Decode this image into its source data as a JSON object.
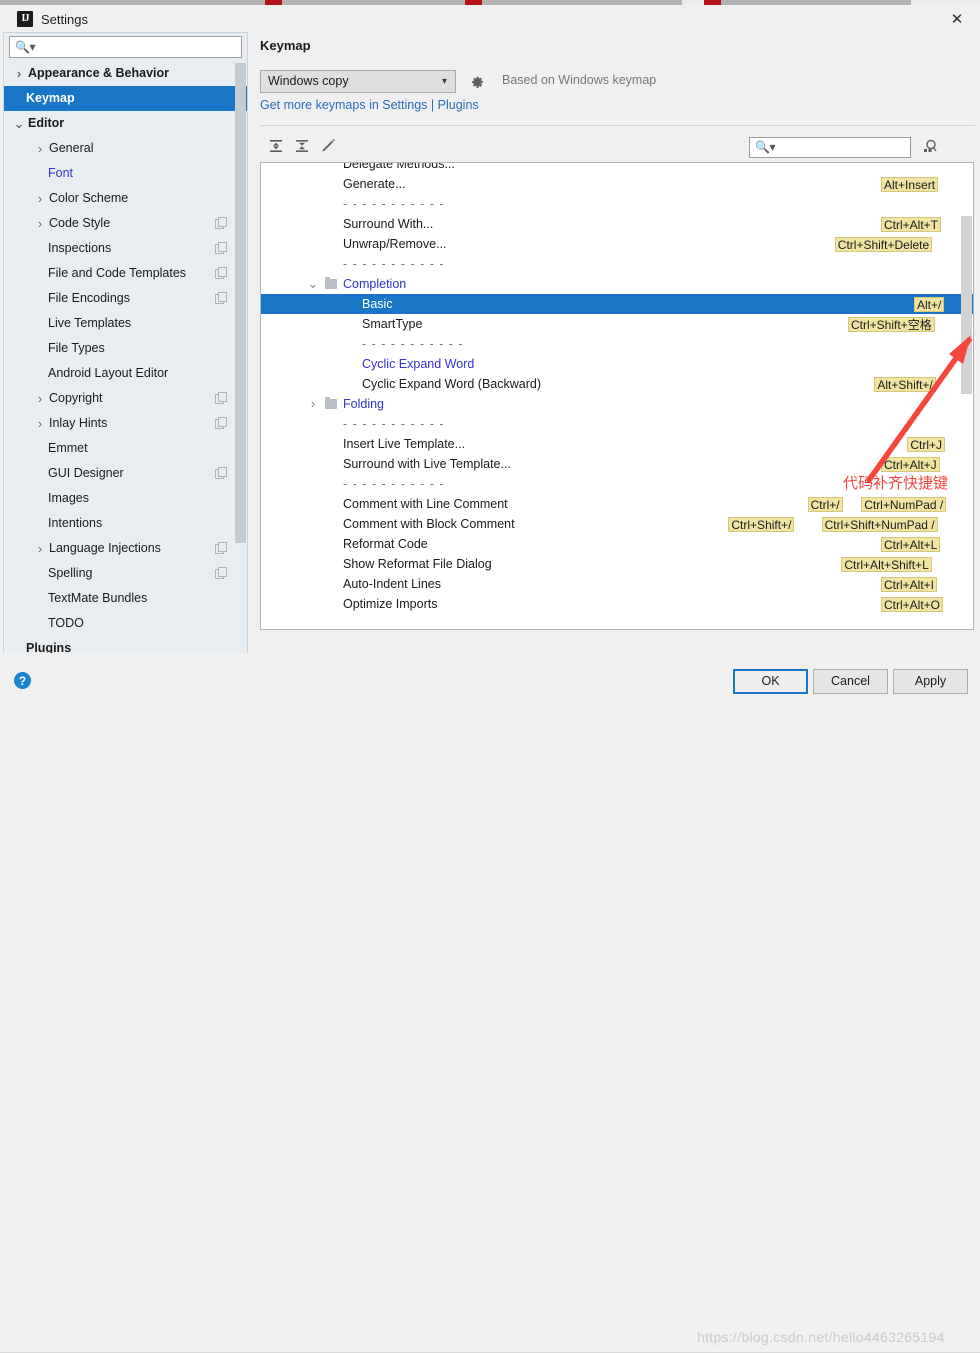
{
  "window": {
    "title": "Settings",
    "logo_text": "IJ",
    "close_icon": "close-icon"
  },
  "sidebar": {
    "search_placeholder": "",
    "search_icon": "search-icon",
    "items": [
      {
        "label": "Appearance & Behavior",
        "indent": 7,
        "chevron": "right",
        "bold": true,
        "selected": false,
        "copy": false
      },
      {
        "label": "Keymap",
        "indent": 22,
        "chevron": "",
        "bold": true,
        "selected": true,
        "copy": false
      },
      {
        "label": "Editor",
        "indent": 7,
        "chevron": "down",
        "bold": true,
        "selected": false,
        "copy": false
      },
      {
        "label": "General",
        "indent": 28,
        "chevron": "right",
        "bold": false,
        "selected": false,
        "copy": false
      },
      {
        "label": "Font",
        "indent": 44,
        "chevron": "",
        "bold": false,
        "selected": false,
        "copy": false,
        "link": true
      },
      {
        "label": "Color Scheme",
        "indent": 28,
        "chevron": "right",
        "bold": false,
        "selected": false,
        "copy": false
      },
      {
        "label": "Code Style",
        "indent": 28,
        "chevron": "right",
        "bold": false,
        "selected": false,
        "copy": true
      },
      {
        "label": "Inspections",
        "indent": 44,
        "chevron": "",
        "bold": false,
        "selected": false,
        "copy": true
      },
      {
        "label": "File and Code Templates",
        "indent": 44,
        "chevron": "",
        "bold": false,
        "selected": false,
        "copy": true
      },
      {
        "label": "File Encodings",
        "indent": 44,
        "chevron": "",
        "bold": false,
        "selected": false,
        "copy": true
      },
      {
        "label": "Live Templates",
        "indent": 44,
        "chevron": "",
        "bold": false,
        "selected": false,
        "copy": false
      },
      {
        "label": "File Types",
        "indent": 44,
        "chevron": "",
        "bold": false,
        "selected": false,
        "copy": false
      },
      {
        "label": "Android Layout Editor",
        "indent": 44,
        "chevron": "",
        "bold": false,
        "selected": false,
        "copy": false
      },
      {
        "label": "Copyright",
        "indent": 28,
        "chevron": "right",
        "bold": false,
        "selected": false,
        "copy": true
      },
      {
        "label": "Inlay Hints",
        "indent": 28,
        "chevron": "right",
        "bold": false,
        "selected": false,
        "copy": true
      },
      {
        "label": "Emmet",
        "indent": 44,
        "chevron": "",
        "bold": false,
        "selected": false,
        "copy": false
      },
      {
        "label": "GUI Designer",
        "indent": 44,
        "chevron": "",
        "bold": false,
        "selected": false,
        "copy": true
      },
      {
        "label": "Images",
        "indent": 44,
        "chevron": "",
        "bold": false,
        "selected": false,
        "copy": false
      },
      {
        "label": "Intentions",
        "indent": 44,
        "chevron": "",
        "bold": false,
        "selected": false,
        "copy": false
      },
      {
        "label": "Language Injections",
        "indent": 28,
        "chevron": "right",
        "bold": false,
        "selected": false,
        "copy": true
      },
      {
        "label": "Spelling",
        "indent": 44,
        "chevron": "",
        "bold": false,
        "selected": false,
        "copy": true
      },
      {
        "label": "TextMate Bundles",
        "indent": 44,
        "chevron": "",
        "bold": false,
        "selected": false,
        "copy": false
      },
      {
        "label": "TODO",
        "indent": 44,
        "chevron": "",
        "bold": false,
        "selected": false,
        "copy": false
      },
      {
        "label": "Plugins",
        "indent": 22,
        "chevron": "",
        "bold": true,
        "selected": false,
        "copy": false
      }
    ]
  },
  "main": {
    "page_title": "Keymap",
    "keymap_select_value": "Windows copy",
    "gear_icon": "gear-icon",
    "based_on": "Based on Windows keymap",
    "link_prefix": "Get more keymaps in Settings",
    "link_sep": "|",
    "link_suffix": "Plugins",
    "toolbar": {
      "expand_all_icon": "expand-all-icon",
      "collapse_all_icon": "collapse-all-icon",
      "edit_icon": "pencil-edit-icon",
      "find_placeholder": "",
      "find_icon": "search-icon",
      "find_by_shortcut_icon": "find-by-shortcut-icon"
    },
    "rows": [
      {
        "type": "action",
        "label": "Delegate Methods...",
        "indent": 82,
        "shortcuts": []
      },
      {
        "type": "action",
        "label": "Generate...",
        "indent": 82,
        "shortcuts": [
          "Alt+Insert"
        ]
      },
      {
        "type": "separator",
        "label": "- - - - - - - - - - -",
        "indent": 82,
        "shortcuts": []
      },
      {
        "type": "action",
        "label": "Surround With...",
        "indent": 82,
        "shortcuts": [
          "Ctrl+Alt+T"
        ]
      },
      {
        "type": "action",
        "label": "Unwrap/Remove...",
        "indent": 82,
        "shortcuts": [
          "Ctrl+Shift+Delete"
        ]
      },
      {
        "type": "separator",
        "label": "- - - - - - - - - - -",
        "indent": 82,
        "shortcuts": []
      },
      {
        "type": "folder",
        "label": "Completion",
        "indent": 68,
        "arrow": "down",
        "shortcuts": []
      },
      {
        "type": "action",
        "label": "Basic",
        "indent": 101,
        "selected": true,
        "shortcuts": [
          "Alt+/"
        ]
      },
      {
        "type": "action",
        "label": "SmartType",
        "indent": 101,
        "shortcuts": [
          "Ctrl+Shift+空格"
        ]
      },
      {
        "type": "separator",
        "label": "- - - - - - - - - - -",
        "indent": 101,
        "shortcuts": []
      },
      {
        "type": "action",
        "label": "Cyclic Expand Word",
        "indent": 101,
        "link": true,
        "shortcuts": []
      },
      {
        "type": "action",
        "label": "Cyclic Expand Word (Backward)",
        "indent": 101,
        "shortcuts": [
          "Alt+Shift+/"
        ]
      },
      {
        "type": "folder",
        "label": "Folding",
        "indent": 68,
        "arrow": "right",
        "shortcuts": []
      },
      {
        "type": "separator",
        "label": "- - - - - - - - - - -",
        "indent": 82,
        "shortcuts": []
      },
      {
        "type": "action",
        "label": "Insert Live Template...",
        "indent": 82,
        "shortcuts": [
          "Ctrl+J"
        ]
      },
      {
        "type": "action",
        "label": "Surround with Live Template...",
        "indent": 82,
        "shortcuts": [
          "Ctrl+Alt+J"
        ]
      },
      {
        "type": "separator",
        "label": "- - - - - - - - - - -",
        "indent": 82,
        "shortcuts": []
      },
      {
        "type": "action",
        "label": "Comment with Line Comment",
        "indent": 82,
        "shortcuts": [
          "Ctrl+/",
          "Ctrl+NumPad /"
        ]
      },
      {
        "type": "action",
        "label": "Comment with Block Comment",
        "indent": 82,
        "shortcuts": [
          "Ctrl+Shift+/",
          "Ctrl+Shift+NumPad /"
        ]
      },
      {
        "type": "action",
        "label": "Reformat Code",
        "indent": 82,
        "shortcuts": [
          "Ctrl+Alt+L"
        ]
      },
      {
        "type": "action",
        "label": "Show Reformat File Dialog",
        "indent": 82,
        "shortcuts": [
          "Ctrl+Alt+Shift+L"
        ]
      },
      {
        "type": "action",
        "label": "Auto-Indent Lines",
        "indent": 82,
        "shortcuts": [
          "Ctrl+Alt+I"
        ]
      },
      {
        "type": "action",
        "label": "Optimize Imports",
        "indent": 82,
        "shortcuts": [
          "Ctrl+Alt+O"
        ]
      }
    ]
  },
  "annotation": {
    "text": "代码补齐快捷键",
    "color": "#f4463c",
    "arrow_icon": "red-arrow-icon"
  },
  "footer": {
    "help_label": "?",
    "ok_label": "OK",
    "cancel_label": "Cancel",
    "apply_label": "Apply",
    "watermark": "https://blog.csdn.net/hello4463265194"
  },
  "colors": {
    "accent": "#1976c6",
    "shortcut_badge": "#efe4a1",
    "sidebar_bg": "#e8edf2",
    "annotation_red": "#f4463c",
    "link_blue": "#2a6db5"
  }
}
